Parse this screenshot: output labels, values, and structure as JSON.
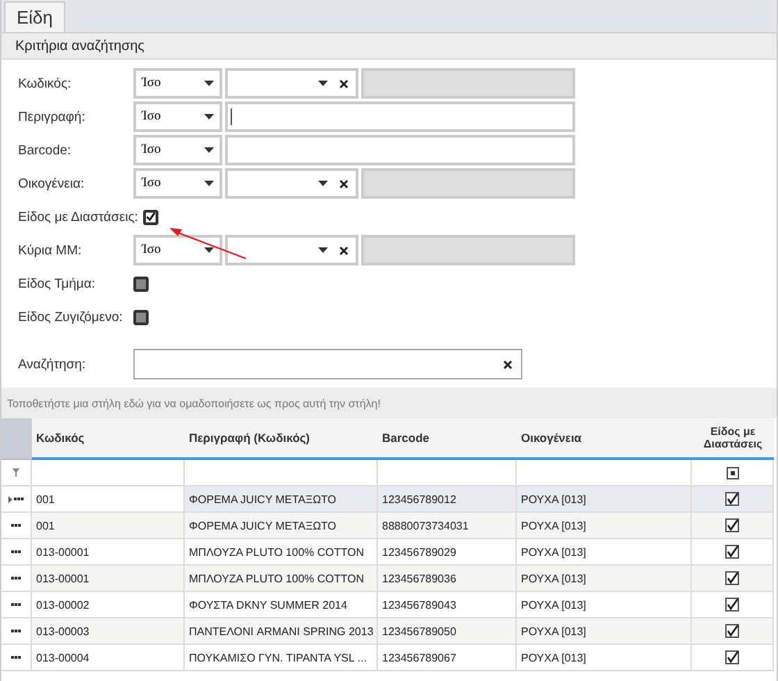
{
  "tabs": [
    {
      "label": "Είδη",
      "selected": true
    }
  ],
  "section_title": "Κριτήρια αναζήτησης",
  "criteria": [
    {
      "kind": "combo",
      "label": "Κωδικός:",
      "operator": "Ίσο"
    },
    {
      "kind": "text",
      "label": "Περιγραφή:",
      "operator": "Ίσο",
      "focused": true
    },
    {
      "kind": "text",
      "label": "Barcode:",
      "operator": "Ίσο",
      "focused": false
    },
    {
      "kind": "combo",
      "label": "Οικογένεια:",
      "operator": "Ίσο"
    },
    {
      "kind": "checkbox",
      "label": "Είδος με Διαστάσεις:",
      "checked": true
    },
    {
      "kind": "combo",
      "label": "Κύρια ΜΜ:",
      "operator": "Ίσο"
    },
    {
      "kind": "checkbox",
      "label": "Είδος Τμήμα:",
      "checked": false
    },
    {
      "kind": "checkbox",
      "label": "Είδος Ζυγιζόμενο:",
      "checked": false
    }
  ],
  "search": {
    "label": "Αναζήτηση:"
  },
  "group_panel_hint": "Τοποθετήστε μια στήλη εδώ για να ομαδοποιήσετε ως προς αυτή την στήλη!",
  "table": {
    "columns": [
      "Κωδικός",
      "Περιγραφή (Κωδικός)",
      "Barcode",
      "Οικογένεια",
      "Είδος με Διαστάσεις"
    ],
    "rows": [
      {
        "code": "001",
        "description": "ΦΟΡΕΜΑ JUICY ΜΕΤΑΞΩΤΟ",
        "barcode": "123456789012",
        "family": "ΡΟΥΧΑ [013]",
        "dimensions": true,
        "selected": true
      },
      {
        "code": "001",
        "description": "ΦΟΡΕΜΑ JUICY ΜΕΤΑΞΩΤΟ",
        "barcode": "88880073734031",
        "family": "ΡΟΥΧΑ [013]",
        "dimensions": true,
        "selected": false
      },
      {
        "code": "013-00001",
        "description": "ΜΠΛΟΥΖΑ PLUTO 100% COTTON",
        "barcode": "123456789029",
        "family": "ΡΟΥΧΑ [013]",
        "dimensions": true,
        "selected": false
      },
      {
        "code": "013-00001",
        "description": "ΜΠΛΟΥΖΑ PLUTO 100% COTTON",
        "barcode": "123456789036",
        "family": "ΡΟΥΧΑ [013]",
        "dimensions": true,
        "selected": false
      },
      {
        "code": "013-00002",
        "description": "ΦΟΥΣΤΑ DKNY SUMMER 2014",
        "barcode": "123456789043",
        "family": "ΡΟΥΧΑ [013]",
        "dimensions": true,
        "selected": false
      },
      {
        "code": "013-00003",
        "description": "ΠΑΝΤΕΛΟΝΙ ARMANI SPRING 2013",
        "barcode": "123456789050",
        "family": "ΡΟΥΧΑ [013]",
        "dimensions": true,
        "selected": false
      },
      {
        "code": "013-00004",
        "description": "ΠΟΥΚΑΜΙΣΟ ΓΥΝ. ΤΙΡΑΝΤΑ YSL ...",
        "barcode": "123456789067",
        "family": "ΡΟΥΧΑ [013]",
        "dimensions": true,
        "selected": false
      }
    ]
  }
}
